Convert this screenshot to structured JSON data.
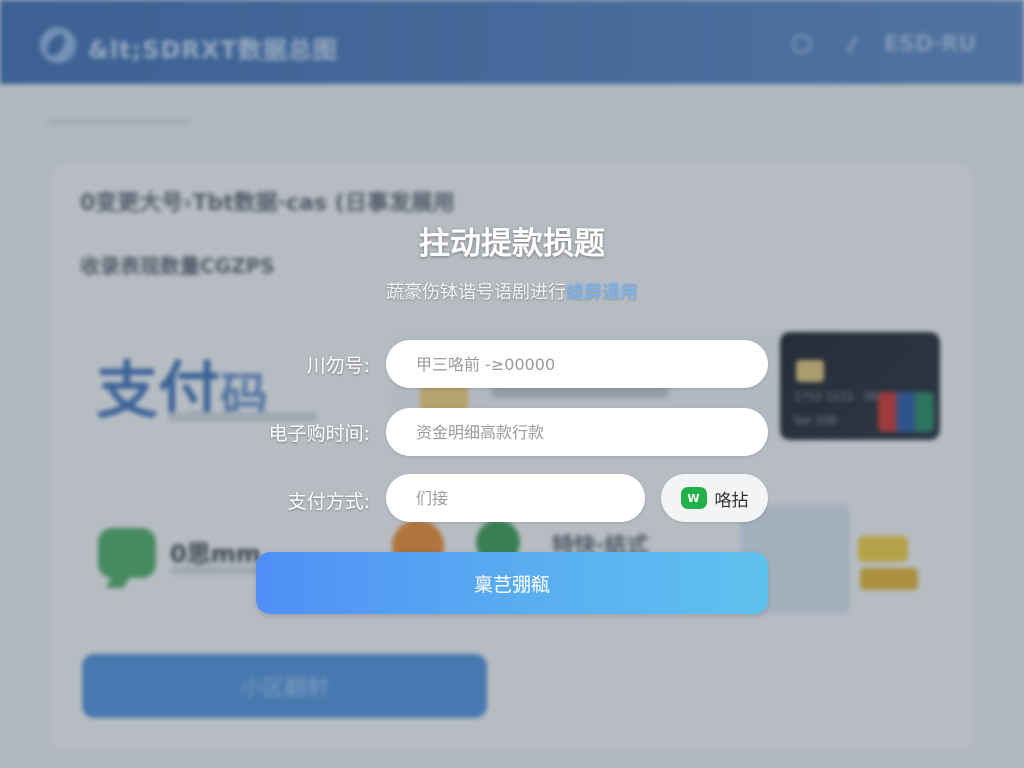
{
  "background": {
    "header": {
      "title": "&lt;SDRXT数据总图",
      "right_text": "ESD·RU"
    },
    "card": {
      "line1": "0变更大号›Tbt数据·cas (日事发展用",
      "line2": "收录表现数量CGZPS"
    },
    "pay_logo": {
      "main": "支付",
      "suffix": "码"
    },
    "bank_card": {
      "number": "1712 1111 · 0000",
      "name": "Ser 100"
    },
    "wechat_tile": {
      "label": "0思mm"
    },
    "mid_text": "特快·结式",
    "button_label": "小区翻射"
  },
  "modal": {
    "title": "拄动提款损题",
    "subtitle_prefix": "蔬豪伤钵谐号语剧进行",
    "subtitle_link": "蜡屏通用",
    "fields": [
      {
        "label": "川勿号:",
        "placeholder": "甲三咯前 -≥00000"
      },
      {
        "label": "电子购时间:",
        "placeholder": "资金明细高款行款"
      },
      {
        "label": "支付方式:",
        "placeholder": "们接"
      }
    ],
    "wechat_button": {
      "icon_text": "W",
      "label": "咯拈"
    },
    "submit_label": "稟芑弸瓻"
  },
  "colors": {
    "accent": "#4f8ff6",
    "accent_end": "#5ec2ef",
    "link": "#6fb7ff",
    "wechat_green": "#22b04b"
  },
  "icons": [
    "logo-icon",
    "settings-icon",
    "edit-icon",
    "wechat-icon",
    "bank-card-icon",
    "unionpay-icon"
  ]
}
